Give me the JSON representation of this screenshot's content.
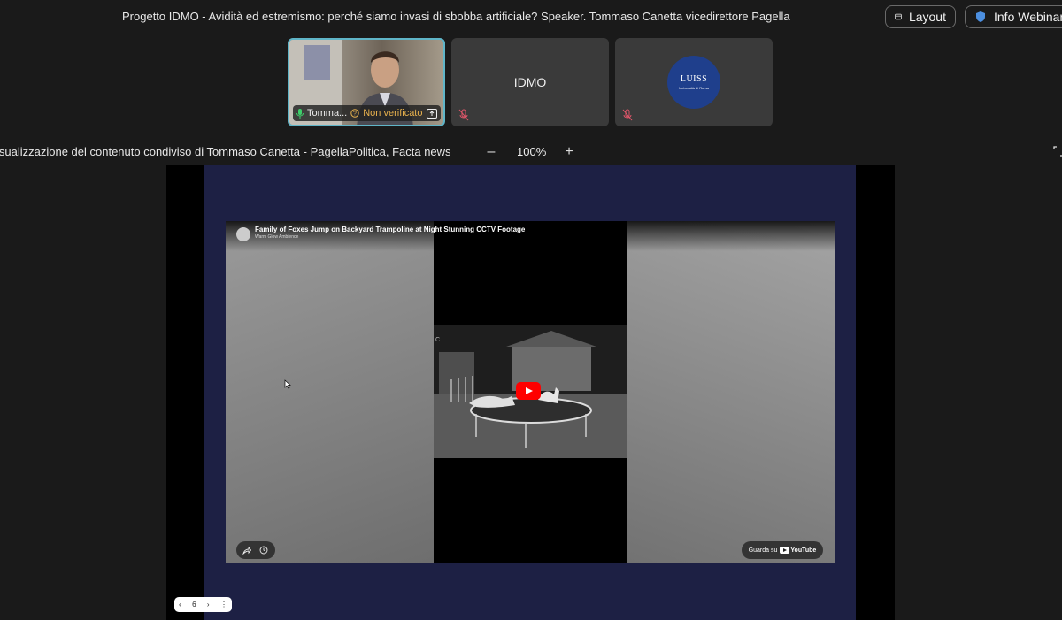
{
  "header": {
    "meeting_title": "Progetto IDMO - Avidità ed estremismo: perché siamo invasi di sbobba artificiale? Speaker. Tommaso Canetta vicedirettore Pagella",
    "layout_label": "Layout",
    "info_label": "Info Webinar"
  },
  "participants": [
    {
      "name": "Tomma...",
      "verification": "Non verificato",
      "type": "video"
    },
    {
      "name": "IDMO",
      "type": "name-only"
    },
    {
      "name": "LUISS",
      "subtitle": "Università di Roma",
      "type": "logo"
    }
  ],
  "share_bar": {
    "description": "isualizzazione del contenuto condiviso di Tommaso Canetta - PagellaPolitica, Facta news",
    "zoom_minus": "–",
    "zoom_level": "100%",
    "zoom_plus": "+"
  },
  "youtube": {
    "title": "Family of Foxes Jump on Backyard Trampoline at Night Stunning CCTV Footage",
    "channel": "Warm Glow Ambience",
    "watch_on": "Guarda su",
    "brand": "YouTube"
  },
  "pager": {
    "prev": "‹",
    "page": "6",
    "next": "›",
    "more": "⋮"
  },
  "colors": {
    "background": "#1a1a1a",
    "active_speaker_border": "#5fb5c8",
    "slide_bg": "#1d2044",
    "luiss_blue": "#1f3f8c",
    "youtube_red": "#ff0000",
    "warning": "#e6b04d"
  }
}
